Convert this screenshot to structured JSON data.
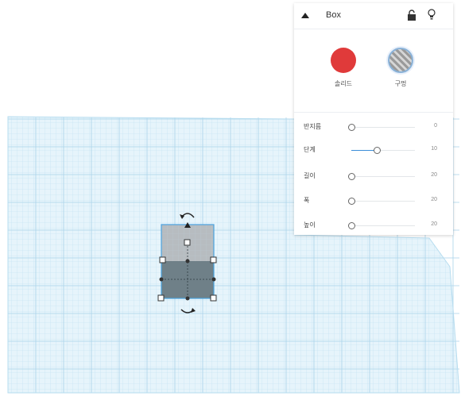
{
  "inspector": {
    "title": "Box",
    "solid_label": "솔리드",
    "hole_label": "구멍",
    "solid_color": "#e03a3a",
    "icons": {
      "collapse": "triangle-up-icon",
      "lock": "lock-icon",
      "visibility": "light-bulb-icon"
    },
    "params": [
      {
        "label": "반지름",
        "value": "0",
        "level": 0.0
      },
      {
        "label": "단계",
        "value": "10",
        "level": 0.4
      },
      {
        "label": "길이",
        "value": "20",
        "level": 0.0
      },
      {
        "label": "폭",
        "value": "20",
        "level": 0.0
      },
      {
        "label": "높이",
        "value": "20",
        "level": 0.0
      }
    ]
  },
  "workplane": {
    "grid_color": "#cfe8f5",
    "plane_color": "#e6f4fb"
  },
  "selected_shape": {
    "type": "box",
    "color": "#7d8c95"
  }
}
